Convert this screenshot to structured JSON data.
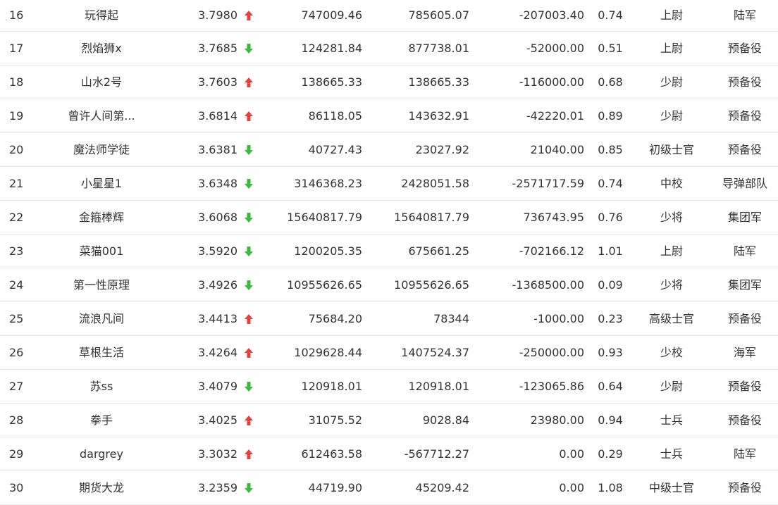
{
  "colors": {
    "up": "#e04444",
    "down": "#3fb83f",
    "text": "#333333",
    "divider": "#ebebeb"
  },
  "rows": [
    {
      "rank": "16",
      "name": "玩得起",
      "score": "3.7980",
      "trend": "up",
      "v1": "747009.46",
      "v2": "785605.07",
      "v3": "-207003.40",
      "ratio": "0.74",
      "rank_name": "上尉",
      "branch": "陆军"
    },
    {
      "rank": "17",
      "name": "烈焰狮x",
      "score": "3.7685",
      "trend": "down",
      "v1": "124281.84",
      "v2": "877738.01",
      "v3": "-52000.00",
      "ratio": "0.51",
      "rank_name": "上尉",
      "branch": "预备役"
    },
    {
      "rank": "18",
      "name": "山水2号",
      "score": "3.7603",
      "trend": "up",
      "v1": "138665.33",
      "v2": "138665.33",
      "v3": "-116000.00",
      "ratio": "0.68",
      "rank_name": "少尉",
      "branch": "预备役"
    },
    {
      "rank": "19",
      "name": "曾许人间第...",
      "score": "3.6814",
      "trend": "up",
      "v1": "86118.05",
      "v2": "143632.91",
      "v3": "-42220.01",
      "ratio": "0.89",
      "rank_name": "少尉",
      "branch": "预备役"
    },
    {
      "rank": "20",
      "name": "魔法师学徒",
      "score": "3.6381",
      "trend": "down",
      "v1": "40727.43",
      "v2": "23027.92",
      "v3": "21040.00",
      "ratio": "0.85",
      "rank_name": "初级士官",
      "branch": "预备役"
    },
    {
      "rank": "21",
      "name": "小星星1",
      "score": "3.6348",
      "trend": "down",
      "v1": "3146368.23",
      "v2": "2428051.58",
      "v3": "-2571717.59",
      "ratio": "0.74",
      "rank_name": "中校",
      "branch": "导弹部队"
    },
    {
      "rank": "22",
      "name": "金箍棒辉",
      "score": "3.6068",
      "trend": "down",
      "v1": "15640817.79",
      "v2": "15640817.79",
      "v3": "736743.95",
      "ratio": "0.76",
      "rank_name": "少将",
      "branch": "集团军"
    },
    {
      "rank": "23",
      "name": "菜猫001",
      "score": "3.5920",
      "trend": "down",
      "v1": "1200205.35",
      "v2": "675661.25",
      "v3": "-702166.12",
      "ratio": "1.01",
      "rank_name": "上尉",
      "branch": "陆军"
    },
    {
      "rank": "24",
      "name": "第一性原理",
      "score": "3.4926",
      "trend": "down",
      "v1": "10955626.65",
      "v2": "10955626.65",
      "v3": "-1368500.00",
      "ratio": "0.09",
      "rank_name": "少将",
      "branch": "集团军"
    },
    {
      "rank": "25",
      "name": "流浪凡间",
      "score": "3.4413",
      "trend": "up",
      "v1": "75684.20",
      "v2": "78344",
      "v3": "-1000.00",
      "ratio": "0.23",
      "rank_name": "高级士官",
      "branch": "预备役"
    },
    {
      "rank": "26",
      "name": "草根生活",
      "score": "3.4264",
      "trend": "up",
      "v1": "1029628.44",
      "v2": "1407524.37",
      "v3": "-250000.00",
      "ratio": "0.93",
      "rank_name": "少校",
      "branch": "海军"
    },
    {
      "rank": "27",
      "name": "苏ss",
      "score": "3.4079",
      "trend": "down",
      "v1": "120918.01",
      "v2": "120918.01",
      "v3": "-123065.86",
      "ratio": "0.64",
      "rank_name": "少尉",
      "branch": "预备役"
    },
    {
      "rank": "28",
      "name": "拳手",
      "score": "3.4025",
      "trend": "up",
      "v1": "31075.52",
      "v2": "9028.84",
      "v3": "23980.00",
      "ratio": "0.94",
      "rank_name": "士兵",
      "branch": "预备役"
    },
    {
      "rank": "29",
      "name": "dargrey",
      "score": "3.3032",
      "trend": "up",
      "v1": "612463.58",
      "v2": "-567712.27",
      "v3": "0.00",
      "ratio": "0.29",
      "rank_name": "士兵",
      "branch": "陆军"
    },
    {
      "rank": "30",
      "name": "期货大龙",
      "score": "3.2359",
      "trend": "down",
      "v1": "44719.90",
      "v2": "45209.42",
      "v3": "0.00",
      "ratio": "1.08",
      "rank_name": "中级士官",
      "branch": "预备役"
    }
  ]
}
